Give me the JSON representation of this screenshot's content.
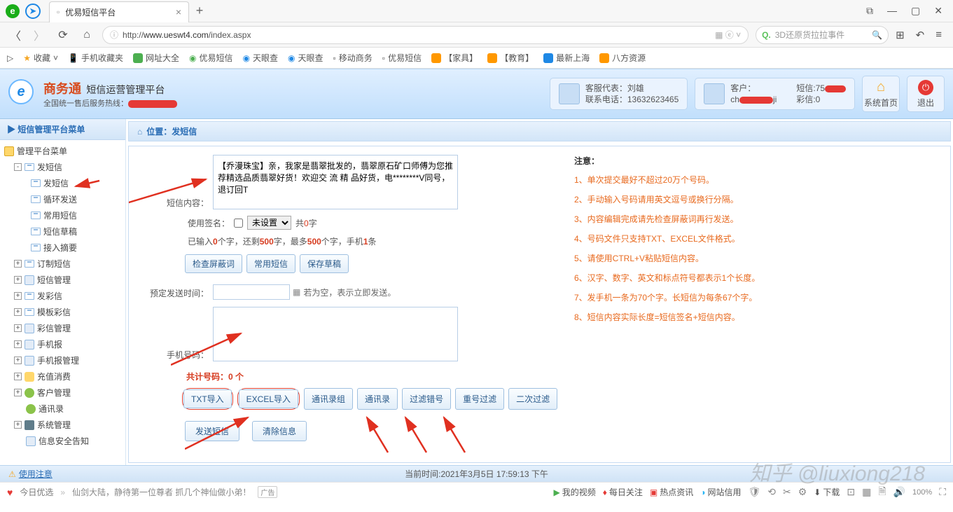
{
  "browser": {
    "tab_title": "优易短信平台",
    "url_prefix": "http://",
    "url_host": "www.ueswt4.com",
    "url_path": "/index.aspx",
    "search_placeholder": "3D还原货拉拉事件"
  },
  "bookmarks": [
    "收藏",
    "手机收藏夹",
    "网址大全",
    "优易短信",
    "天眼查",
    "天眼查",
    "移动商务",
    "优易短信",
    "【家具】",
    "【教育】",
    "最新上海",
    "八方资源"
  ],
  "header": {
    "brand1": "商务通",
    "brand2": "短信运营管理平台",
    "hotline_label": "全国统一售后服务热线：",
    "rep_label": "客服代表：刘雄",
    "rep_phone": "联系电话：13632623465",
    "client_label": "客户：",
    "client_name_prefix": "ch",
    "client_name_suffix": "ji",
    "sms_label": "短信:75",
    "mms_label": "彩信:0",
    "home_btn": "系统首页",
    "exit_btn": "退出"
  },
  "sidebar": {
    "title": "短信管理平台菜单",
    "root": "管理平台菜单",
    "items": [
      {
        "label": "发短信",
        "expanded": true,
        "children": [
          "发短信",
          "循环发送",
          "常用短信",
          "短信草稿",
          "接入摘要"
        ]
      },
      {
        "label": "订制短信"
      },
      {
        "label": "短信管理"
      },
      {
        "label": "发彩信"
      },
      {
        "label": "模板彩信"
      },
      {
        "label": "彩信管理"
      },
      {
        "label": "手机报"
      },
      {
        "label": "手机报管理"
      },
      {
        "label": "充值消费"
      },
      {
        "label": "客户管理"
      },
      {
        "label": "通讯录",
        "icon": "u"
      },
      {
        "label": "系统管理"
      },
      {
        "label": "信息安全告知",
        "icon": "p"
      }
    ]
  },
  "crumb": {
    "prefix": "位置：",
    "value": "发短信"
  },
  "form": {
    "content_label": "短信内容：",
    "content_value": "【乔漫珠宝】亲，我家是翡翠批发的，翡翠原石矿口师傅为您推荐精选品质翡翠好货！欢迎交 流 精 品好货，电********V同号，退订回T",
    "sig_label": "使用签名：",
    "sig_select": "未设置",
    "sig_total_prefix": "共",
    "sig_total_suffix": "字",
    "sig_total_num": "0",
    "count_p1": "已输入",
    "count_v1": "0",
    "count_p2": "个字，还剩",
    "count_v2": "500",
    "count_p3": "字，最多",
    "count_v3": "500",
    "count_p4": "个字，手机",
    "count_v4": "1",
    "count_p5": "条",
    "btn_check": "检查屏蔽词",
    "btn_common": "常用短信",
    "btn_draft": "保存草稿",
    "time_label": "预定发送时间：",
    "time_hint": "若为空，表示立即发送。",
    "phone_label": "手机号码：",
    "phone_total": "共计号码：0 个",
    "btn_txt": "TXT导入",
    "btn_excel": "EXCEL导入",
    "btn_addr_grp": "通讯录组",
    "btn_addr": "通讯录",
    "btn_wrong": "过滤错号",
    "btn_dup": "重号过滤",
    "btn_sec": "二次过滤",
    "btn_send": "发送短信",
    "btn_clear": "清除信息"
  },
  "notes": {
    "heading": "注意：",
    "items": [
      "1、单次提交最好不超过20万个号码。",
      "2、手动输入号码请用英文逗号或换行分隔。",
      "3、内容编辑完成请先检查屏蔽词再行发送。",
      "4、号码文件只支持TXT、EXCEL文件格式。",
      "5、请使用CTRL+V粘贴短信内容。",
      "6、汉字、数字、英文和标点符号都表示1个长度。",
      "7、发手机一条为70个字。长短信为每条67个字。",
      "8、短信内容实际长度=短信签名+短信内容。"
    ]
  },
  "footer": {
    "use_notice": "使用注意",
    "time": "当前时间:2021年3月5日 17:59:13 下午",
    "today": "今日优选",
    "adtext": "仙剑大陆，静待第一位尊者 抓几个神仙做小弟！",
    "adlabel": "广告",
    "items": [
      "我的视频",
      "每日关注",
      "热点资讯",
      "网站信用",
      "下载"
    ]
  },
  "watermark": "知乎 @liuxiong218"
}
